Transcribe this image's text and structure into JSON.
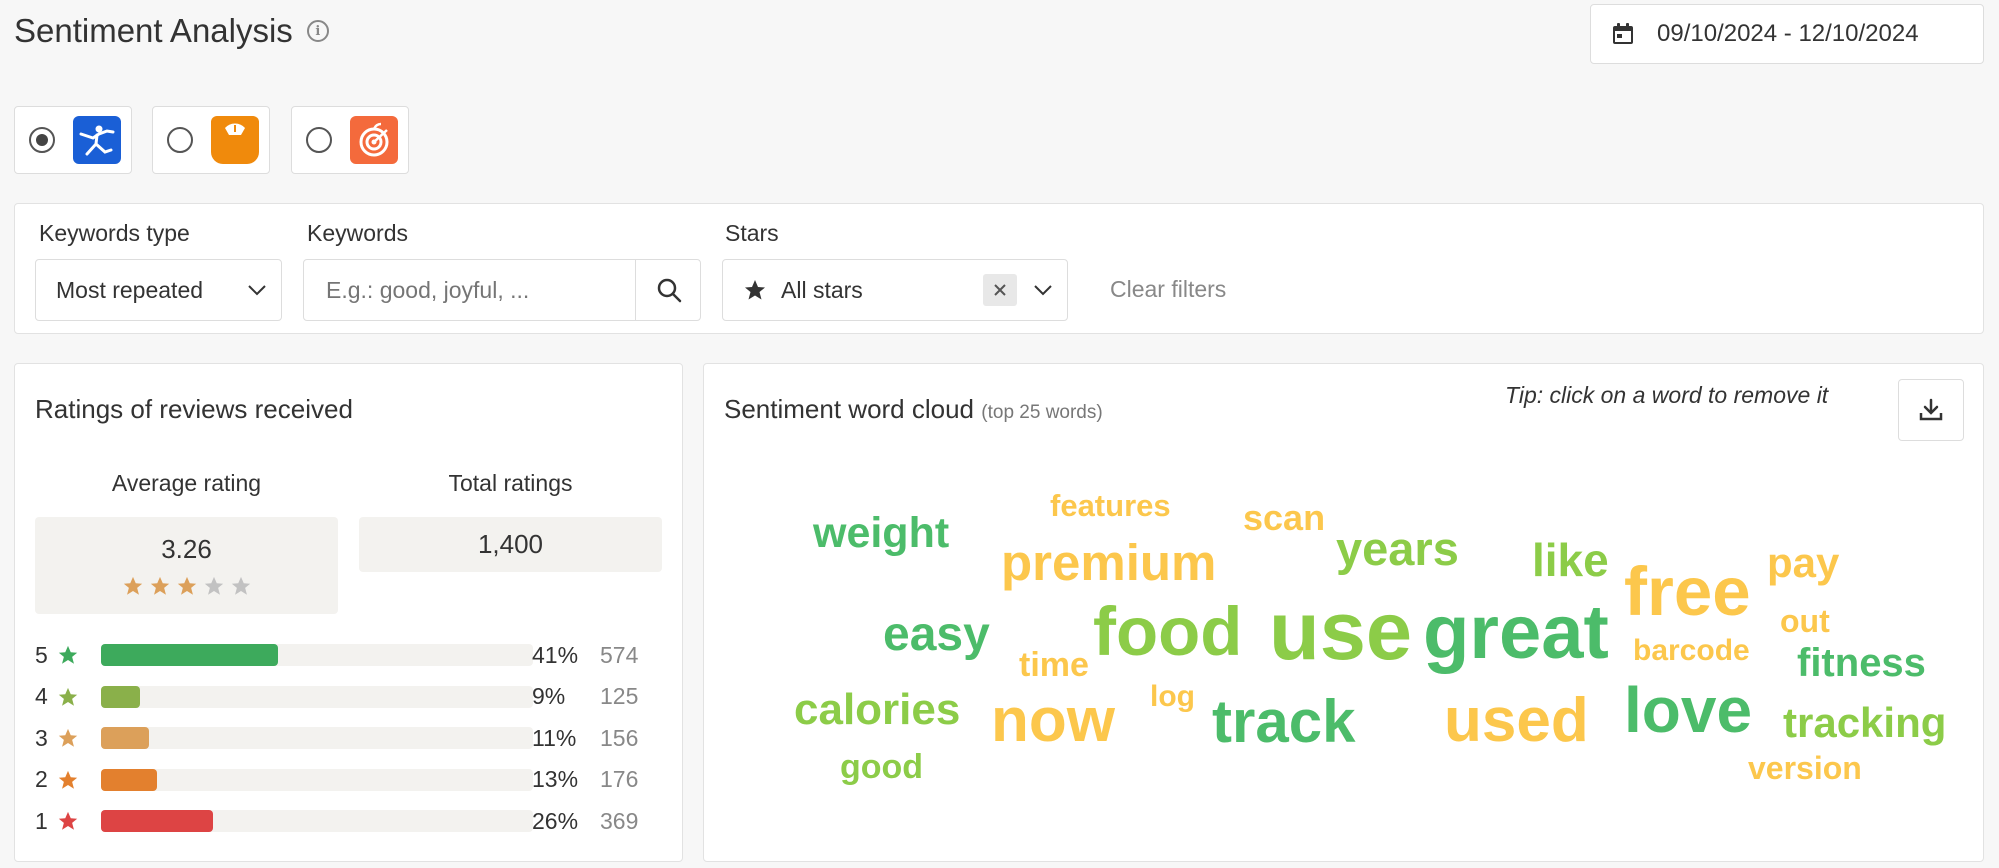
{
  "header": {
    "title": "Sentiment Analysis",
    "date_range": "09/10/2024 - 12/10/2024"
  },
  "apps": [
    {
      "selected": true,
      "icon": "stretching-person-icon",
      "color": "#1a5fd6"
    },
    {
      "selected": false,
      "icon": "scale-icon",
      "color": "#f08a0c"
    },
    {
      "selected": false,
      "icon": "apple-target-icon",
      "color": "#f46a3c"
    }
  ],
  "filters": {
    "keywords_type_label": "Keywords type",
    "keywords_type_value": "Most repeated",
    "keywords_label": "Keywords",
    "keywords_placeholder": "E.g.: good, joyful, ...",
    "stars_label": "Stars",
    "stars_value": "All stars",
    "clear_label": "Clear filters"
  },
  "ratings": {
    "title": "Ratings of reviews received",
    "average_label": "Average rating",
    "average_value": "3.26",
    "average_stars": 3,
    "total_label": "Total ratings",
    "total_value": "1,400",
    "rows": [
      {
        "stars": "5",
        "percent": 41,
        "percent_label": "41%",
        "count": "574",
        "color": "#3daa5c",
        "star_color": "#3daa5c"
      },
      {
        "stars": "4",
        "percent": 9,
        "percent_label": "9%",
        "count": "125",
        "color": "#8ab04a",
        "star_color": "#8ab04a"
      },
      {
        "stars": "3",
        "percent": 11,
        "percent_label": "11%",
        "count": "156",
        "color": "#dca05a",
        "star_color": "#dca05a"
      },
      {
        "stars": "2",
        "percent": 13,
        "percent_label": "13%",
        "count": "176",
        "color": "#e3802e",
        "star_color": "#e3802e"
      },
      {
        "stars": "1",
        "percent": 26,
        "percent_label": "26%",
        "count": "369",
        "color": "#dd4444",
        "star_color": "#dd4444"
      }
    ]
  },
  "wordcloud": {
    "title": "Sentiment word cloud",
    "subtitle": "(top 25 words)",
    "tip": "Tip: click on a word to remove it",
    "download_icon": "download-icon",
    "colors": {
      "green": "#4cbc6a",
      "lime": "#8ccc48",
      "yellow": "#fcc74c"
    },
    "words": [
      {
        "text": "weight",
        "color": "green"
      },
      {
        "text": "features",
        "color": "yellow"
      },
      {
        "text": "scan",
        "color": "yellow"
      },
      {
        "text": "premium",
        "color": "yellow"
      },
      {
        "text": "years",
        "color": "lime"
      },
      {
        "text": "like",
        "color": "lime"
      },
      {
        "text": "free",
        "color": "yellow"
      },
      {
        "text": "pay",
        "color": "yellow"
      },
      {
        "text": "easy",
        "color": "green"
      },
      {
        "text": "food",
        "color": "lime"
      },
      {
        "text": "use",
        "color": "lime"
      },
      {
        "text": "great",
        "color": "green"
      },
      {
        "text": "out",
        "color": "yellow"
      },
      {
        "text": "time",
        "color": "yellow"
      },
      {
        "text": "barcode",
        "color": "yellow"
      },
      {
        "text": "fitness",
        "color": "green"
      },
      {
        "text": "calories",
        "color": "lime"
      },
      {
        "text": "log",
        "color": "yellow"
      },
      {
        "text": "now",
        "color": "yellow"
      },
      {
        "text": "track",
        "color": "green"
      },
      {
        "text": "used",
        "color": "yellow"
      },
      {
        "text": "love",
        "color": "green"
      },
      {
        "text": "tracking",
        "color": "lime"
      },
      {
        "text": "good",
        "color": "lime"
      },
      {
        "text": "version",
        "color": "yellow"
      }
    ]
  }
}
